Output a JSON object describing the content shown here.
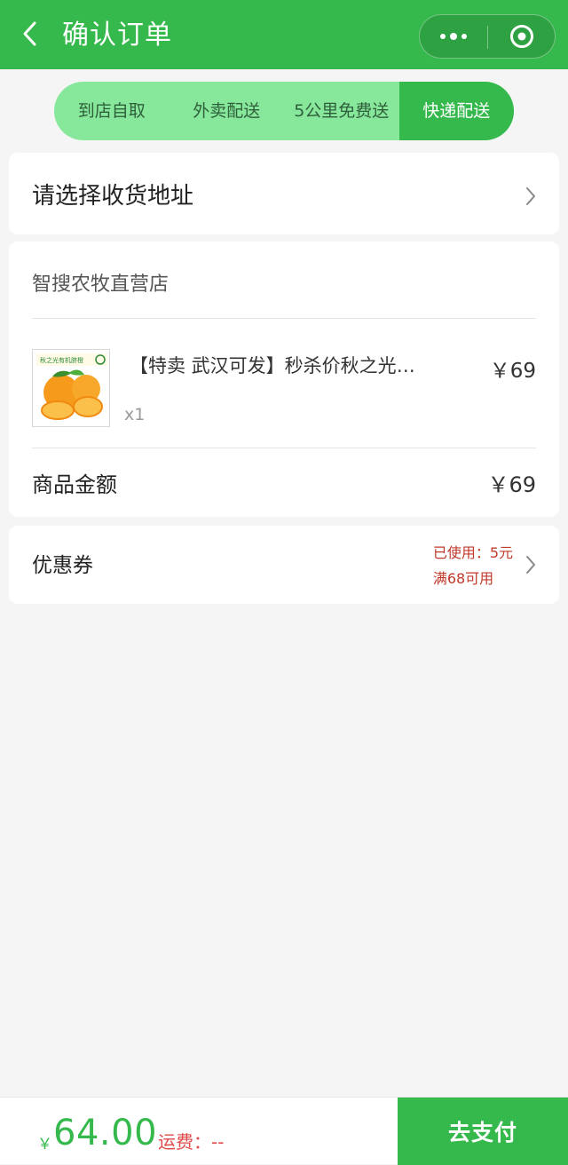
{
  "header": {
    "title": "确认订单",
    "back_icon": "chevron-left-icon",
    "more_icon": "more-dots-icon",
    "close_icon": "target-circle-icon"
  },
  "delivery_tabs": [
    {
      "label": "到店自取",
      "active": false
    },
    {
      "label": "外卖配送",
      "active": false
    },
    {
      "label": "5公里免费送",
      "active": false
    },
    {
      "label": "快递配送",
      "active": true
    }
  ],
  "address": {
    "placeholder": "请选择收货地址"
  },
  "shop": {
    "name": "智搜农牧直营店",
    "product": {
      "name": "【特卖 武汉可发】秒杀价秋之光有机脐橙",
      "quantity": "x1",
      "price": "￥69",
      "image_icon": "orange-product-image"
    },
    "subtotal_label": "商品金额",
    "subtotal_value": "￥69"
  },
  "coupon": {
    "label": "优惠券",
    "used": "已使用：5元",
    "condition": "满68可用"
  },
  "footer": {
    "currency": "￥",
    "total": "64.00",
    "freight": "运费：--",
    "pay_button": "去支付"
  },
  "colors": {
    "brand_green": "#35b94c",
    "tab_light_green": "#87e89c",
    "coupon_red": "#c0392b",
    "freight_red": "#e04a4a"
  }
}
